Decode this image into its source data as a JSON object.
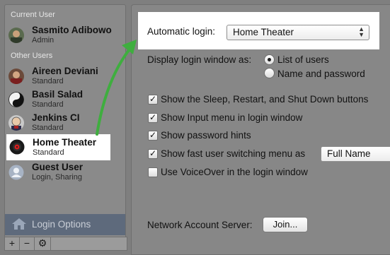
{
  "sidebar": {
    "current_user_header": "Current User",
    "other_users_header": "Other Users",
    "current_user": {
      "name": "Sasmito Adibowo",
      "role": "Admin"
    },
    "other_users": [
      {
        "name": "Aireen Deviani",
        "role": "Standard",
        "selected": false
      },
      {
        "name": "Basil Salad",
        "role": "Standard",
        "selected": false
      },
      {
        "name": "Jenkins CI",
        "role": "Standard",
        "selected": false
      },
      {
        "name": "Home Theater",
        "role": "Standard",
        "selected": true
      },
      {
        "name": "Guest User",
        "role": "Login, Sharing",
        "selected": false
      }
    ],
    "login_options_label": "Login Options",
    "bottom_buttons": {
      "add": "+",
      "remove": "−",
      "action": "⚙"
    }
  },
  "main": {
    "automatic_login_label": "Automatic login:",
    "automatic_login_value": "Home Theater",
    "display_login_label": "Display login window as:",
    "radio_list_label": "List of users",
    "radio_list_selected": true,
    "radio_name_label": "Name and password",
    "radio_name_selected": false,
    "options": [
      {
        "label": "Show the Sleep, Restart, and Shut Down buttons",
        "checked": true
      },
      {
        "label": "Show Input menu in login window",
        "checked": true
      },
      {
        "label": "Show password hints",
        "checked": true
      },
      {
        "label": "Show fast user switching menu as",
        "checked": true
      },
      {
        "label": "Use VoiceOver in the login window",
        "checked": false
      }
    ],
    "fast_switch_value": "Full Name",
    "network_account_label": "Network Account Server:",
    "join_button_label": "Join..."
  },
  "colors": {
    "annotation_arrow": "#3fae3f",
    "highlight": "#ffffff",
    "login_options_bg": "#5e6a7c"
  }
}
